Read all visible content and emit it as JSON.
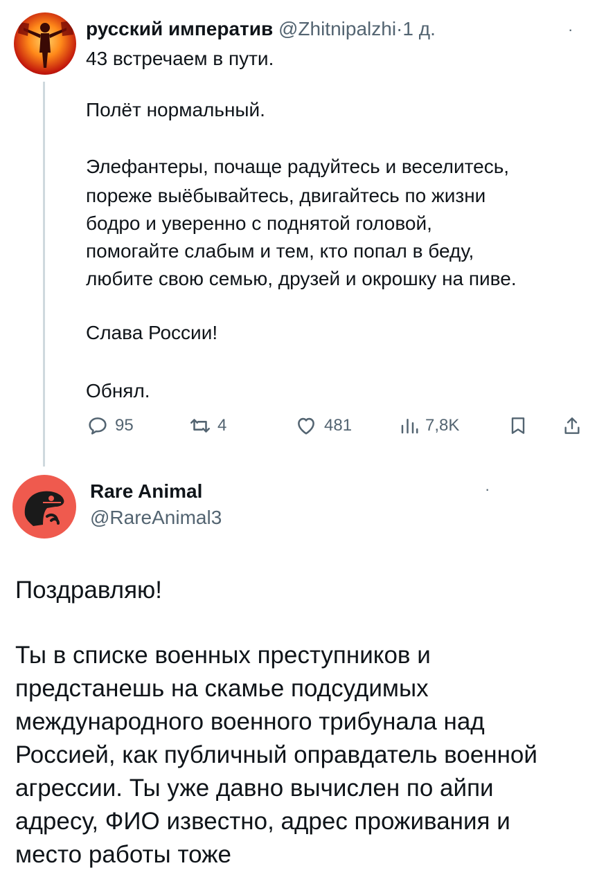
{
  "tweet1": {
    "author_name": "русский императив",
    "author_handle": "@Zhitnipalzhi",
    "separator": "·",
    "time": "1 д.",
    "more": "·",
    "lines": [
      "43 встречаем в пути.",
      "Полёт нормальный.",
      "Элефантеры, почаще радуйтесь и веселитесь,",
      "пореже выёбывайтесь, двигайтесь по жизни",
      "бодро и уверенно с поднятой головой,",
      "помогайте слабым и тем, кто попал в беду,",
      "любите свою семью, друзей и окрошку на пиве.",
      "Слава России!",
      "Обнял."
    ],
    "actions": {
      "replies": "95",
      "reposts": "4",
      "likes": "481",
      "views": "7,8K"
    }
  },
  "tweet2": {
    "author_name": "Rare Animal",
    "author_handle": "@RareAnimal3",
    "more": "·",
    "lines": [
      "Поздравляю!",
      "Ты в списке военных преступников и",
      "предстанешь на скамье подсудимых",
      "международного военного трибунала над",
      "Россией, как публичный оправдатель военной",
      "агрессии. Ты уже давно вычислен по айпи",
      "адресу, ФИО известно, адрес проживания и",
      "место работы тоже"
    ]
  },
  "icons": [
    "reply-icon",
    "repost-icon",
    "like-icon",
    "views-icon",
    "bookmark-icon",
    "share-icon"
  ],
  "colors": {
    "muted": "#536471",
    "text": "#0f1419",
    "thread_line": "#cfd9de",
    "avatar2_bg": "#ef5a4e"
  }
}
